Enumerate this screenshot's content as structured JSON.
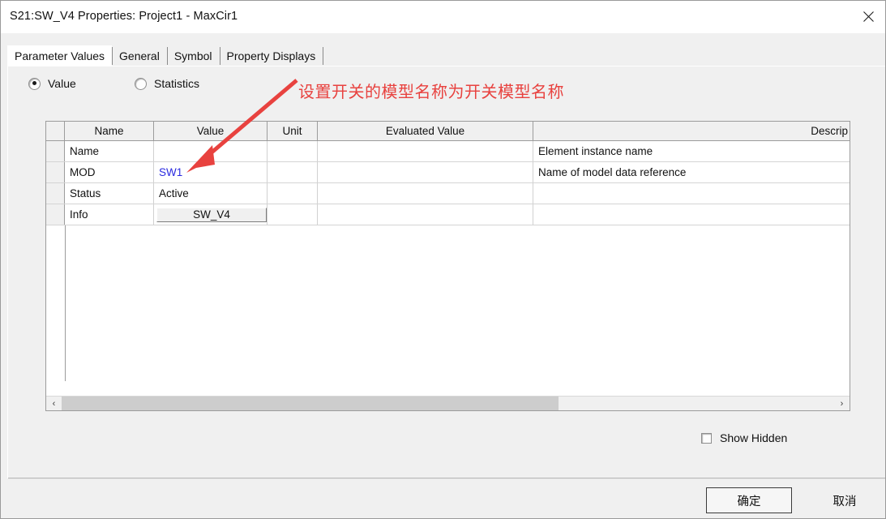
{
  "window": {
    "title": "S21:SW_V4 Properties: Project1 - MaxCir1",
    "close_label": "✕"
  },
  "tabs": [
    {
      "label": "Parameter Values",
      "active": true
    },
    {
      "label": "General",
      "active": false
    },
    {
      "label": "Symbol",
      "active": false
    },
    {
      "label": "Property Displays",
      "active": false
    }
  ],
  "radio_group": {
    "options": [
      {
        "label": "Value",
        "selected": true
      },
      {
        "label": "Statistics",
        "selected": false
      }
    ]
  },
  "grid": {
    "columns": [
      "",
      "Name",
      "Value",
      "Unit",
      "Evaluated Value",
      "Descrip"
    ],
    "rows": [
      {
        "name": "Name",
        "value": "",
        "unit": "",
        "evaluated": "",
        "description": "Element instance name",
        "value_style": "text"
      },
      {
        "name": "MOD",
        "value": "SW1",
        "unit": "",
        "evaluated": "",
        "description": "Name of model data reference",
        "value_style": "blue"
      },
      {
        "name": "Status",
        "value": "Active",
        "unit": "",
        "evaluated": "",
        "description": "",
        "value_style": "text"
      },
      {
        "name": "Info",
        "value": "SW_V4",
        "unit": "",
        "evaluated": "",
        "description": "",
        "value_style": "button"
      }
    ]
  },
  "scrollbar": {
    "left_arrow": "‹",
    "right_arrow": "›"
  },
  "show_hidden": {
    "label": "Show Hidden",
    "checked": false
  },
  "footer": {
    "ok_label": "确定",
    "cancel_label": "取消"
  },
  "annotation": {
    "text": "设置开关的模型名称为开关模型名称",
    "color": "#e8423f"
  }
}
